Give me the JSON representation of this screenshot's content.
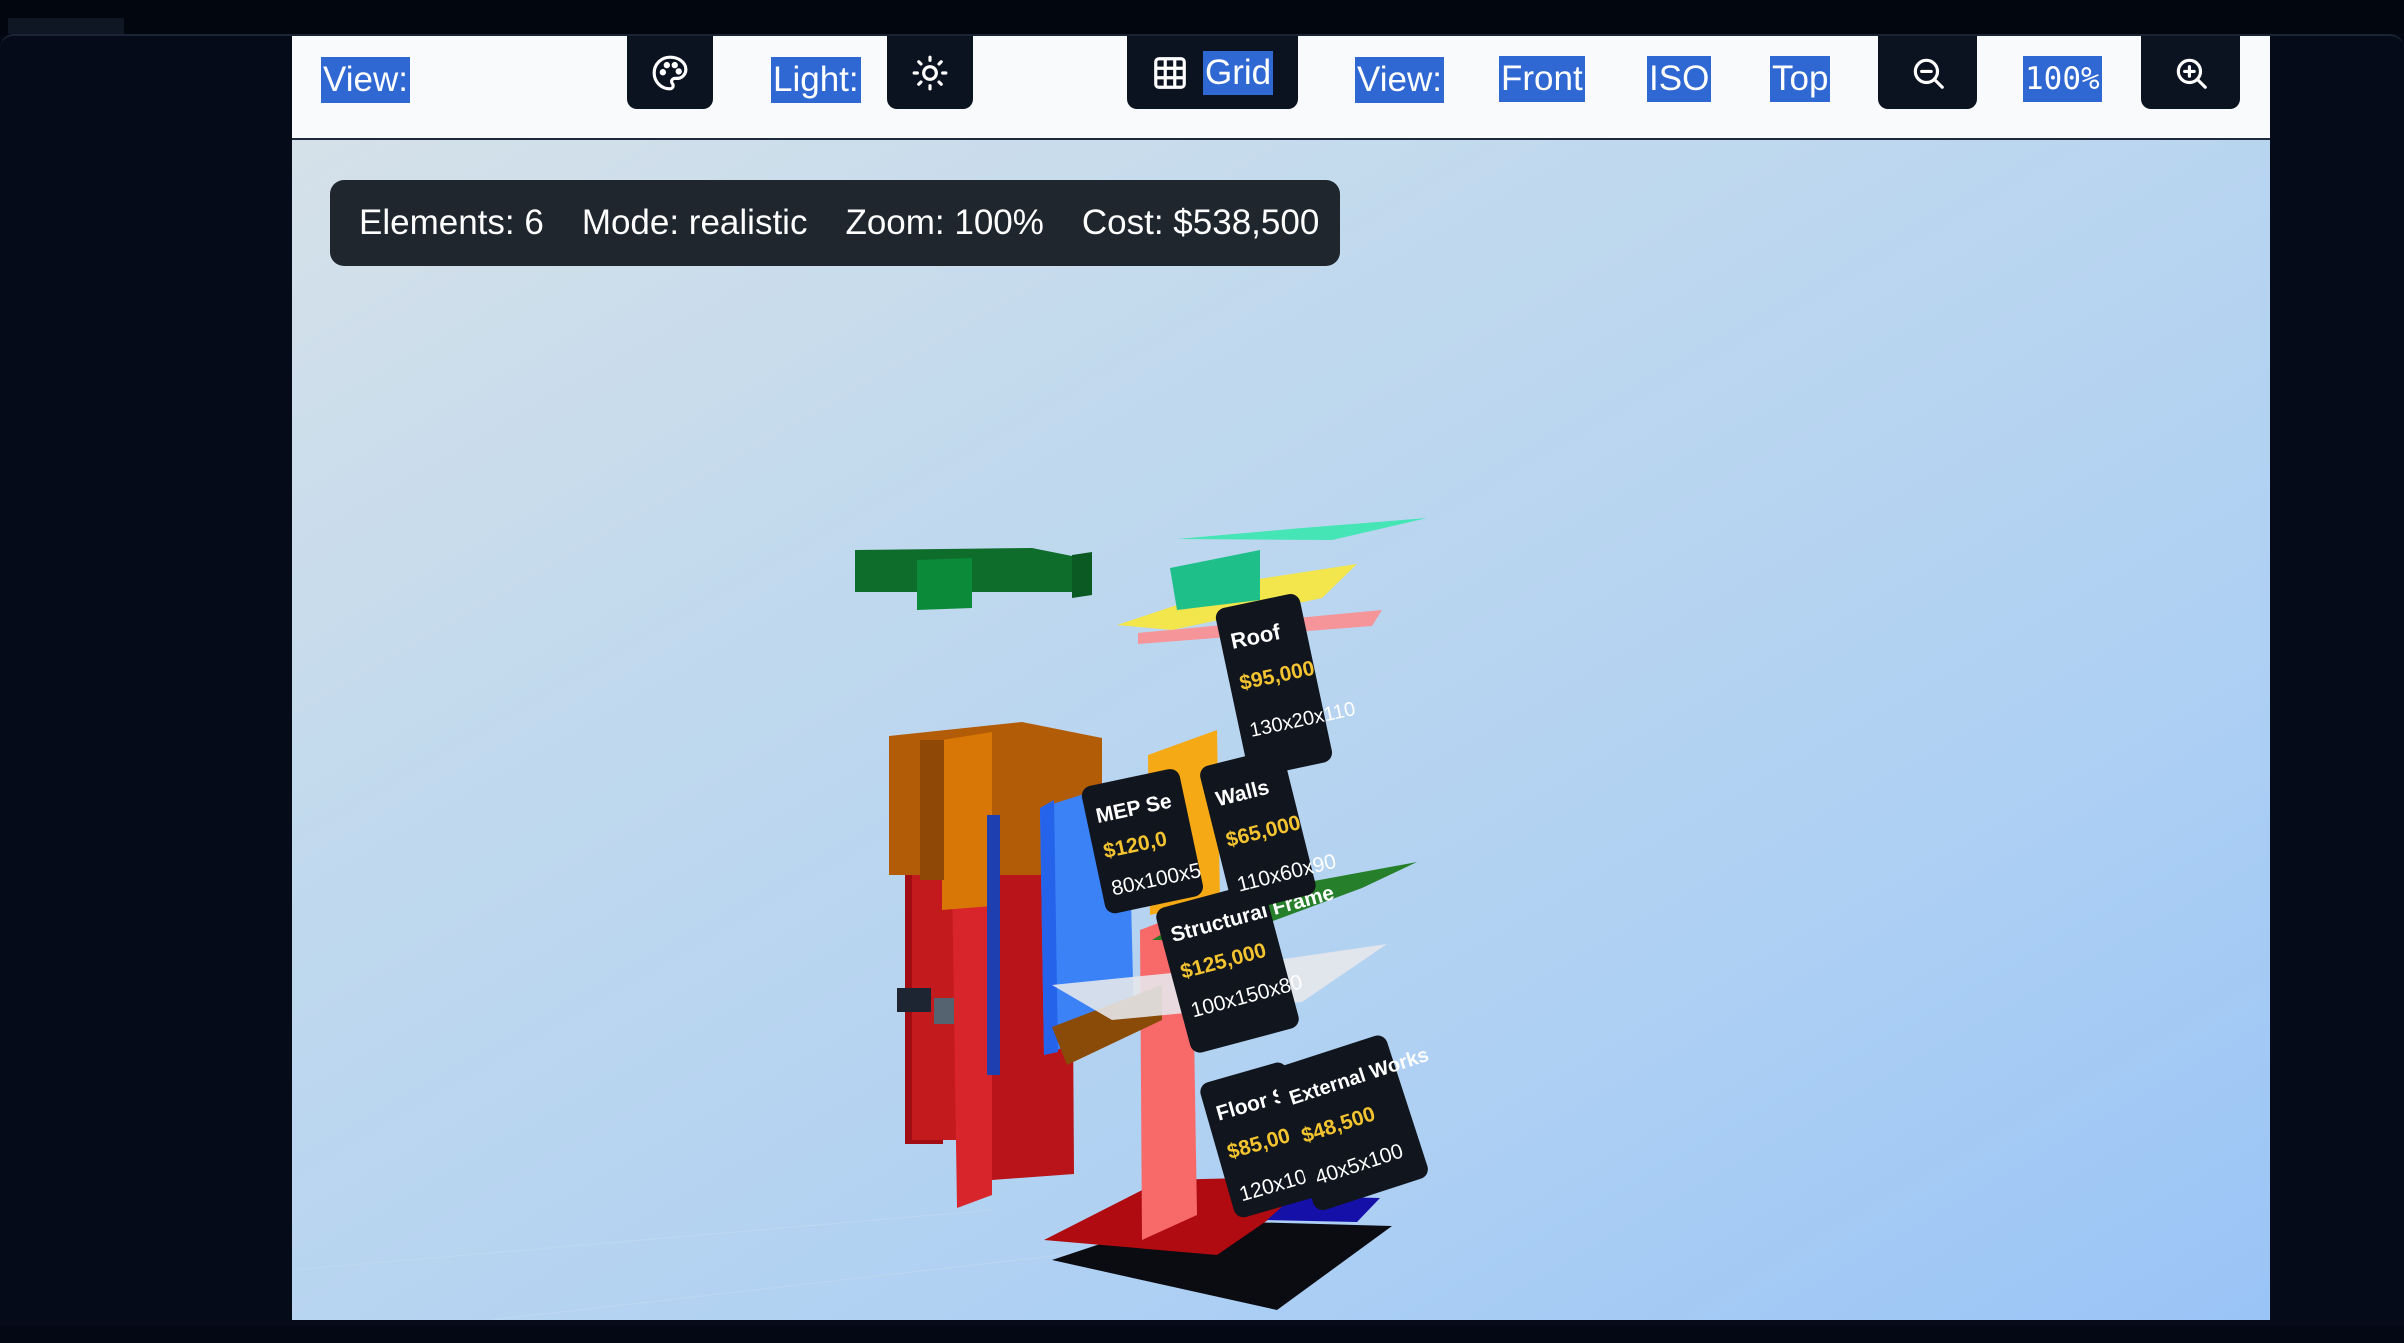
{
  "toolbar": {
    "view_label": "View:",
    "light_label": "Light:",
    "grid_label": "Grid",
    "view2_label": "View:",
    "front_label": "Front",
    "iso_label": "ISO",
    "top_label": "Top",
    "zoom_value": "100%",
    "icons": {
      "palette": "palette-icon",
      "light": "sun-icon",
      "grid": "grid-icon",
      "zoom_out": "zoom-out-icon",
      "zoom_in": "zoom-in-icon"
    }
  },
  "stats": {
    "elements": "Elements: 6",
    "mode": "Mode: realistic",
    "zoom": "Zoom: 100%",
    "cost": "Cost: $538,500"
  },
  "elements": [
    {
      "name": "Roof",
      "cost": "$95,000",
      "dims": "130x20x110"
    },
    {
      "name": "Walls",
      "cost": "$65,000",
      "dims": "110x60x90"
    },
    {
      "name": "MEP Se",
      "cost": "$120,0",
      "dims": "80x100x5"
    },
    {
      "name": "Structural Frame",
      "cost": "$125,000",
      "dims": "100x150x80"
    },
    {
      "name": "Floor Sl",
      "cost": "$85,00",
      "dims": "120x10"
    },
    {
      "name": "External Works",
      "cost": "$48,500",
      "dims": "40x5x100"
    }
  ],
  "colors": {
    "selection": "#2f67d3",
    "toolbar_bg": "#f8fafc",
    "button_bg": "#0b1220",
    "stats_bg": "#1f262d",
    "price": "#f4c430"
  }
}
